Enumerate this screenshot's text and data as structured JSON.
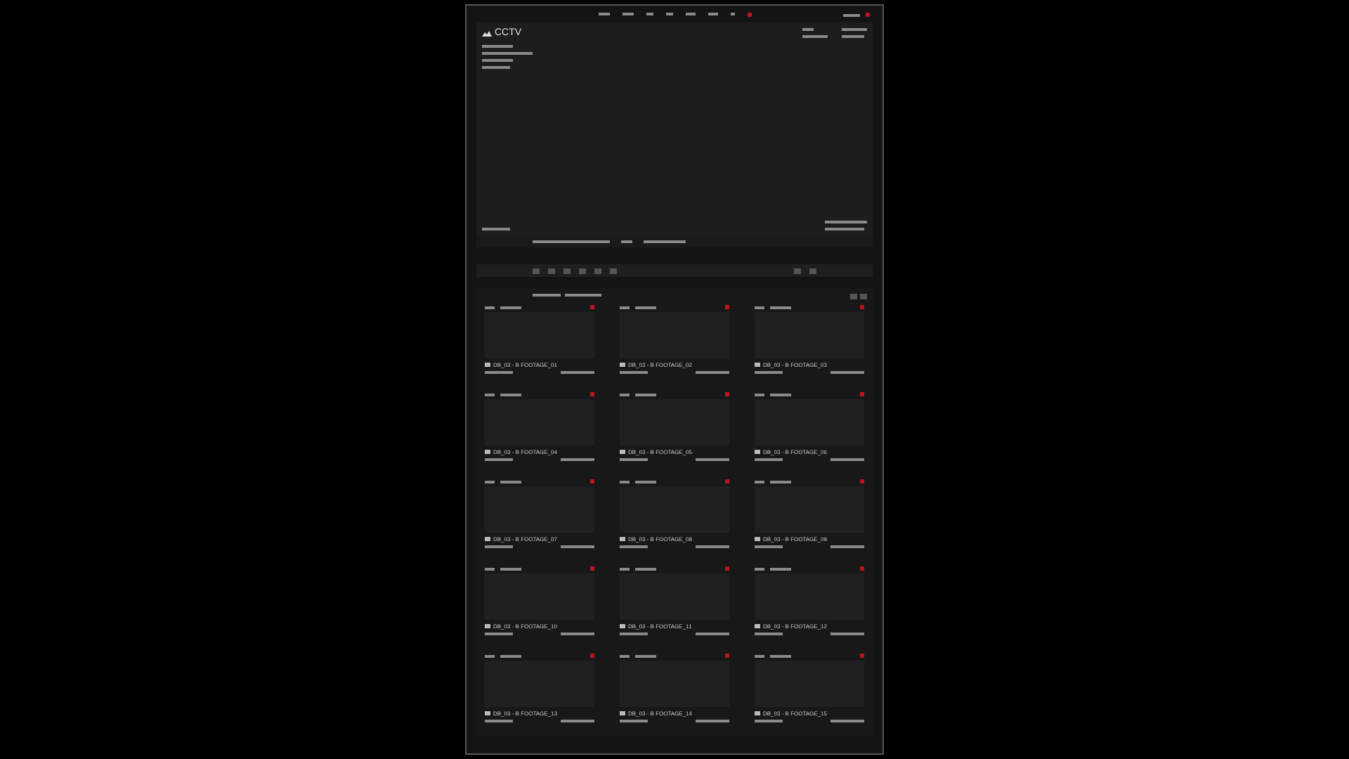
{
  "logo": {
    "text": "CCTV"
  },
  "clips": [
    {
      "title": "DB_03 - B FOOTAGE_01"
    },
    {
      "title": "DB_03 - B FOOTAGE_02"
    },
    {
      "title": "DB_03 - B FOOTAGE_03"
    },
    {
      "title": "DB_03 - B FOOTAGE_04"
    },
    {
      "title": "DB_03 - B FOOTAGE_05"
    },
    {
      "title": "DB_03 - B FOOTAGE_06"
    },
    {
      "title": "DB_03 - B FOOTAGE_07"
    },
    {
      "title": "DB_03 - B FOOTAGE_08"
    },
    {
      "title": "DB_03 - B FOOTAGE_09"
    },
    {
      "title": "DB_03 - B FOOTAGE_10"
    },
    {
      "title": "DB_03 - B FOOTAGE_11"
    },
    {
      "title": "DB_03 - B FOOTAGE_12"
    },
    {
      "title": "DB_03 - B FOOTAGE_13"
    },
    {
      "title": "DB_03 - B FOOTAGE_14"
    },
    {
      "title": "DB_03 - B FOOTAGE_15"
    }
  ]
}
